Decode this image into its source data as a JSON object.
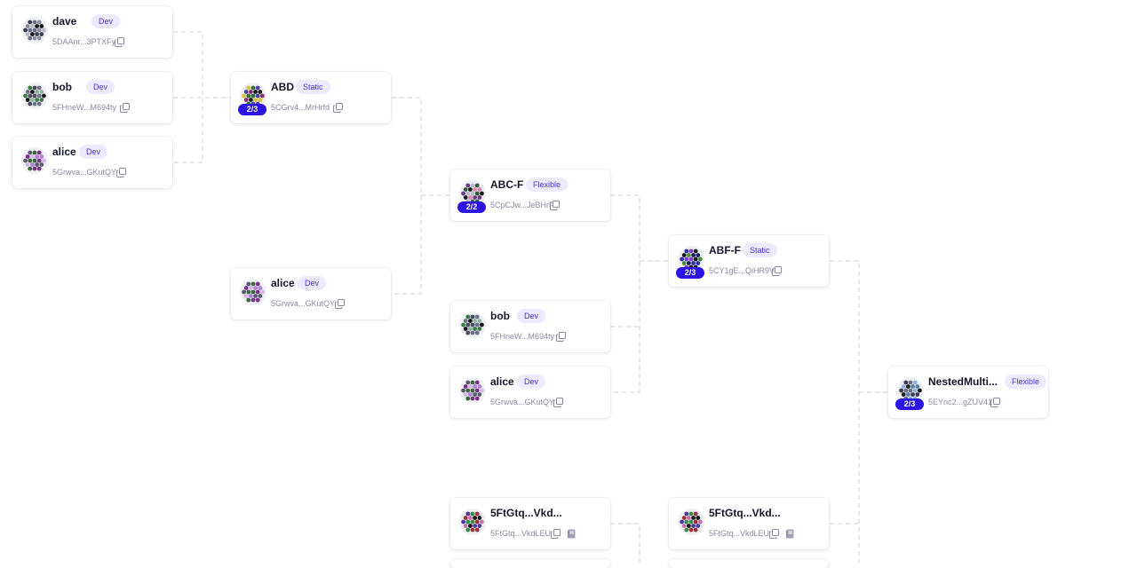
{
  "nodes": {
    "dave_top": {
      "name": "dave",
      "badge": "Dev",
      "address": "5DAAnr...3PTXFy",
      "icon": "identicon",
      "copy_icon": "copy-icon"
    },
    "bob_top": {
      "name": "bob",
      "badge": "Dev",
      "address": "5FHneW...M694ty",
      "icon": "identicon",
      "copy_icon": "copy-icon"
    },
    "alice_top": {
      "name": "alice",
      "badge": "Dev",
      "address": "5Grwva...GKutQY",
      "icon": "identicon",
      "copy_icon": "copy-icon"
    },
    "abd": {
      "name": "ABD",
      "badge": "Static",
      "threshold": "2/3",
      "address": "5CGrv4...MrHrfd",
      "icon": "identicon",
      "copy_icon": "copy-icon"
    },
    "alice_mid": {
      "name": "alice",
      "badge": "Dev",
      "address": "5Grwva...GKutQY",
      "icon": "identicon",
      "copy_icon": "copy-icon"
    },
    "abc_f": {
      "name": "ABC-F",
      "badge": "Flexible",
      "threshold": "2/2",
      "address": "5CpCJw...JeBHrF",
      "icon": "identicon",
      "copy_icon": "copy-icon"
    },
    "bob_mid": {
      "name": "bob",
      "badge": "Dev",
      "address": "5FHneW...M694ty",
      "icon": "identicon",
      "copy_icon": "copy-icon"
    },
    "alice_low": {
      "name": "alice",
      "badge": "Dev",
      "address": "5Grwva...GKutQY",
      "icon": "identicon",
      "copy_icon": "copy-icon"
    },
    "abf_f": {
      "name": "ABF-F",
      "badge": "Static",
      "threshold": "2/3",
      "address": "5CY1gE...QiHR9V",
      "icon": "identicon",
      "copy_icon": "copy-icon"
    },
    "nested": {
      "name": "NestedMulti...",
      "badge": "Flexible",
      "threshold": "2/3",
      "address": "5EYnc2...gZUV41",
      "icon": "identicon",
      "copy_icon": "copy-icon"
    },
    "ftg_1": {
      "name": "5FtGtq...Vkd...",
      "address": "5FtGtq...VkdLEU",
      "icon": "identicon",
      "copy_icon": "copy-icon",
      "extra_icon": "book-icon"
    },
    "ftg_2": {
      "name": "5FtGtq...Vkd...",
      "address": "5FtGtq...VkdLEU",
      "icon": "identicon",
      "copy_icon": "copy-icon",
      "extra_icon": "book-icon"
    }
  },
  "colors": {
    "threshold_bg": "#2d14e6",
    "badge_bg": "#eeeafd",
    "badge_text": "#4b30d9",
    "connector": "#cfcfd8"
  }
}
